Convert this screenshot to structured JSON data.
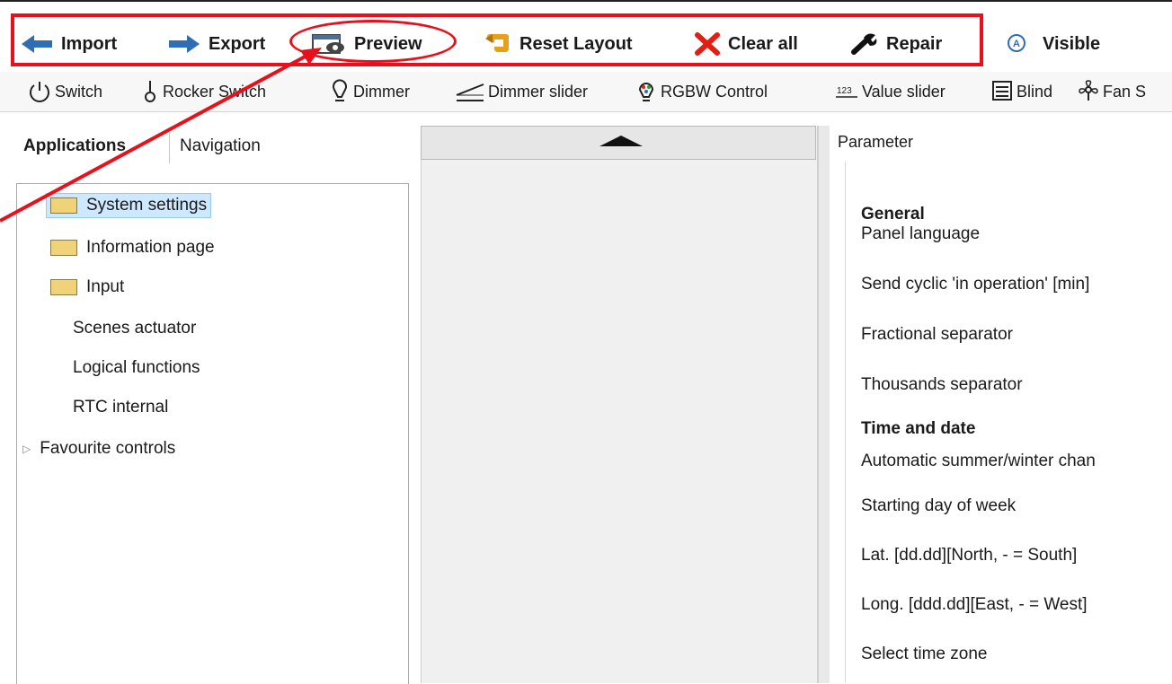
{
  "toolbar": {
    "import": "Import",
    "export": "Export",
    "preview": "Preview",
    "reset_layout": "Reset Layout",
    "clear_all": "Clear all",
    "repair": "Repair",
    "visible": "Visible"
  },
  "controls": [
    {
      "label": "Switch",
      "icon": "power-icon"
    },
    {
      "label": "Rocker Switch",
      "icon": "rocker-icon"
    },
    {
      "label": "Dimmer",
      "icon": "dimmer-icon"
    },
    {
      "label": "Dimmer slider",
      "icon": "slider-icon"
    },
    {
      "label": "RGBW Control",
      "icon": "rgbw-bulb-icon"
    },
    {
      "label": "Value slider",
      "icon": "value-123-icon"
    },
    {
      "label": "Blind",
      "icon": "blind-icon"
    },
    {
      "label": "Fan S",
      "icon": "fan-icon"
    }
  ],
  "left": {
    "tabs": [
      "Applications",
      "Navigation"
    ],
    "tree": [
      {
        "label": "System settings",
        "folder": true,
        "selected": true
      },
      {
        "label": "Information page",
        "folder": true
      },
      {
        "label": "Input",
        "folder": true
      },
      {
        "label": "Scenes actuator"
      },
      {
        "label": "Logical functions"
      },
      {
        "label": "RTC internal"
      },
      {
        "label": "Favourite controls",
        "expander": true
      }
    ]
  },
  "right": {
    "header": "Parameter",
    "rows": [
      {
        "label": "General",
        "heading": true
      },
      {
        "label": "Panel language"
      },
      {
        "label": "Send cyclic 'in operation' [min]"
      },
      {
        "label": "Fractional separator"
      },
      {
        "label": "Thousands separator"
      },
      {
        "label": "Time and date",
        "heading": true
      },
      {
        "label": "Automatic summer/winter chan"
      },
      {
        "label": "Starting day of week"
      },
      {
        "label": "Lat. [dd.dd][North, - = South]"
      },
      {
        "label": "Long. [ddd.dd][East, - = West]"
      },
      {
        "label": "Select time zone"
      }
    ]
  },
  "colors": {
    "highlight": "#e8101b",
    "folder": "#f0d378",
    "selection": "#cde8ff"
  }
}
